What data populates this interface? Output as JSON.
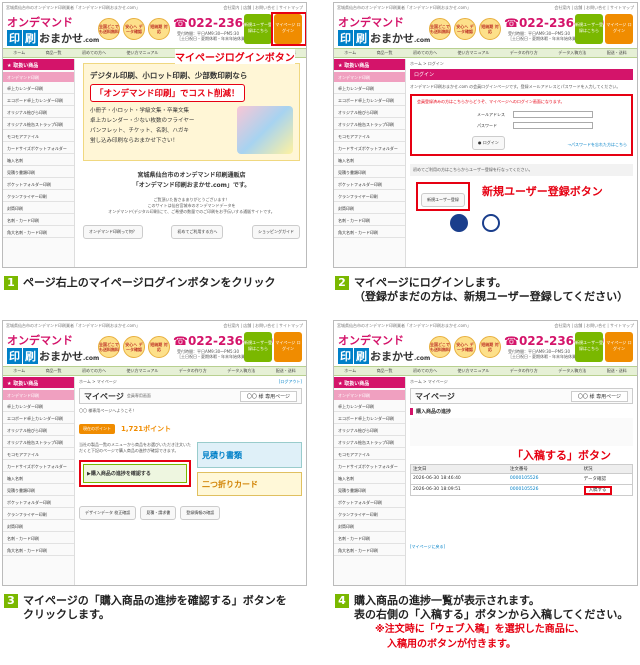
{
  "site": {
    "topline": "宮城県仙台市のオンデマンド印刷業者「オンデマンド印刷おまかせ.com」",
    "topline_right": "会社案内 | 店舗 | お問い合せ | サイトマップ",
    "logo_top": "オンデマンド",
    "logo_box1": "印",
    "logo_box2": "刷",
    "logo_text": "おまかせ",
    "logo_com": ".com",
    "badges": [
      "全国どこでも送料無料",
      "安心へ データ確認",
      "短納期 対応"
    ],
    "phone": "022-236-7202",
    "hours_1": "受付時間：平日AM9:30～PM5:30",
    "hours_2": "［土日祝日・夏期休暇・年末年始休業を除く］",
    "top_btns": [
      "新規ユーザー登録はこちら",
      "マイページ ログイン"
    ],
    "nav": [
      "ホーム",
      "商品一覧",
      "初めての方へ",
      "使い方マニュアル",
      "データの作り方",
      "データ入稿方法",
      "配送・送料"
    ],
    "side_head": "取扱い商品",
    "side_sub": "オンデマンド印刷",
    "side_items": [
      "卓上カレンダー印刷",
      "エコボード卓上カレンダー印刷",
      "オリジナル絵びら印刷",
      "オリジナル絵缶ストラップ印刷",
      "モコモアファイル",
      "カードサイズポケットフォルダー",
      "箱入名刺",
      "見積り書類印刷",
      "ポケットフォルダー印刷",
      "クランフライヤー印刷",
      "封筒印刷",
      "名刺・カード印刷",
      "角大名刺・カード印刷"
    ]
  },
  "p1": {
    "callout": "マイページログインボタン",
    "hero_1": "デジタル印刷、小ロット印刷、少部数印刷なら",
    "hero_2": "「オンデマンド印刷」でコスト削減！",
    "list": [
      "小冊子・小ロット・学級文集・卒業文集",
      "卓上カレンダー・少ない枚数のフライヤー",
      "パンフレット、チケット、名刺、ハガキ",
      "蛍し込み印刷ならおまかせ下さい！"
    ],
    "pr_1": "宮城県仙台市のオンデマンド印刷通販店",
    "pr_2": "「オンデマンド印刷おまかせ.com」です。",
    "small_1": "ご覧頂いた皆さまありがとうございます！",
    "small_2": "このサイトは仙台宮城市のオンデマンドデータを",
    "small_3": "オンデマンド(デジタル印刷)にて、ご希望の数量でのご印刷をお手伝いする通販サイトです。",
    "btns": [
      "オンデマンド印刷って何？",
      "初めてご利用する方へ",
      "ショッピングガイド"
    ]
  },
  "p2": {
    "crumb": "ホーム > ログイン",
    "title": "ログイン",
    "intro": "オンデマンド印刷おまかせ.com の会員ログインページです。登録メールアドレスとパスワードを入力してください。",
    "box_title": "会員登録済みの方はこちらからどうぞ、マイページへのログイン画面になります。",
    "email_label": "メールアドレス",
    "pass_label": "パスワード",
    "login_btn": "ログイン",
    "forgot": "→パスワードを忘れた方はこちら",
    "new_lead": "初めてご利用の方はこちらからユーザー登録を行なってください。",
    "new_btn": "新規ユーザー登録",
    "callout": "新規ユーザー登録ボタン"
  },
  "p3": {
    "crumb": "ホーム > マイページ",
    "logout": "[ログアウト]",
    "mp_title": "マイページ",
    "mp_sub": "会員専用画面",
    "user": "〇〇 様 専用ページ",
    "msg": "〇〇 様専用ページへようこそ！",
    "points_label": "現在のポイント",
    "points": "1,721ポイント",
    "flow_text": "当社の製品一覧のメニューから商品をお選びいただき注文いただくと下記のページで購入商品の進捗が確認できます。",
    "progress_btn": "購入商品の進捗を確認する",
    "estimate": "見積り書類",
    "nichi": "二つ折りカード",
    "bottom": [
      "デザインデータ 校正確認",
      "見積・請求書",
      "登録情報の確認"
    ]
  },
  "p4": {
    "crumb": "ホーム > マイページ",
    "mp_title": "マイページ",
    "user": "〇〇 様 専用ページ",
    "list_title": "購入商品の進捗",
    "headers": [
      "注文日",
      "注文番号",
      "状況"
    ],
    "rows": [
      [
        "2026-06-30 18:46:40",
        "0000105526",
        "データ確認"
      ],
      [
        "2026-06-30 18:09:51",
        "0000105526",
        "入稿する"
      ]
    ],
    "callout": "「入稿する」ボタン",
    "nyuko": "入稿する",
    "back": "[マイページに戻る]"
  },
  "captions": {
    "c1": "ページ右上のマイページログインボタンをクリック",
    "c2a": "マイページにログインします。",
    "c2b": "（登録がまだの方は、新規ユーザー登録してください）",
    "c3a": "マイページの「購入商品の進捗を確認する」ボタンを",
    "c3b": "クリックします。",
    "c4a": "購入商品の進捗一覧が表示されます。",
    "c4b": "表の右側の「入稿する」ボタンから入稿してください。",
    "c4c": "※注文時に「ウェブ入稿」を選択した商品に、",
    "c4d": "入稿用のボタンが付きます。"
  },
  "colors": {
    "accent": "#d4146a",
    "brand_blue": "#0080c8",
    "callout": "#e60012",
    "step": "#7ab800"
  }
}
